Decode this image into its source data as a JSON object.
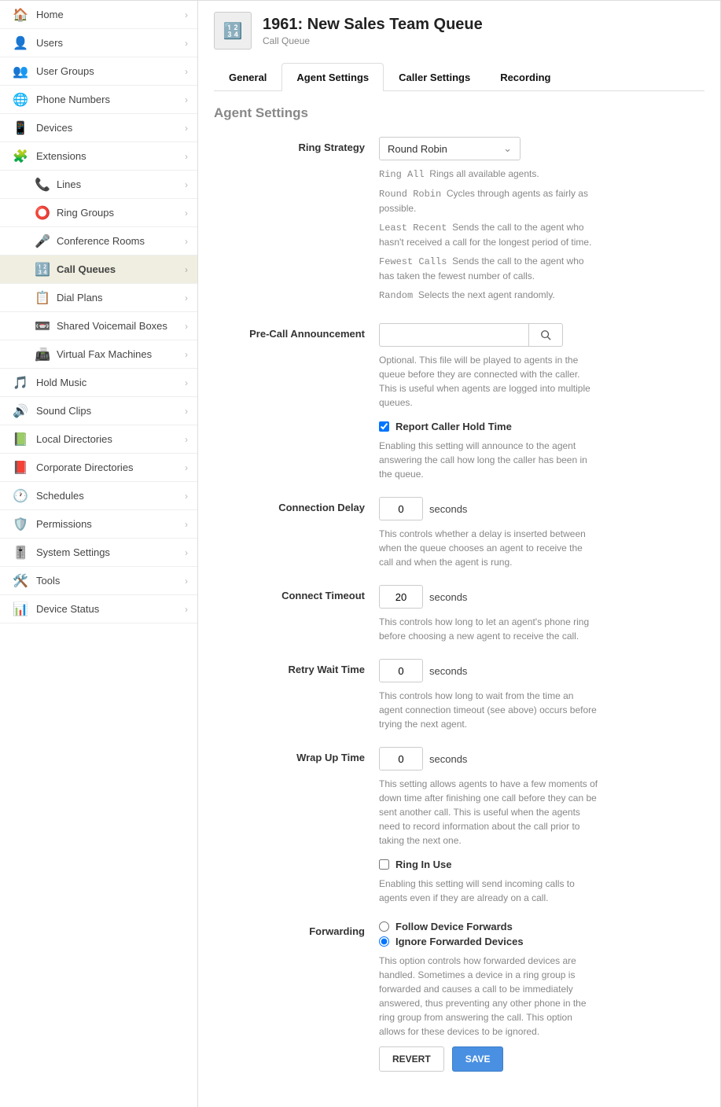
{
  "header": {
    "title": "1961: New Sales Team Queue",
    "subtitle": "Call Queue"
  },
  "tabs": [
    {
      "label": "General",
      "active": false
    },
    {
      "label": "Agent Settings",
      "active": true
    },
    {
      "label": "Caller Settings",
      "active": false
    },
    {
      "label": "Recording",
      "active": false
    }
  ],
  "section_title": "Agent Settings",
  "sidebar": [
    {
      "label": "Home",
      "sub": false
    },
    {
      "label": "Users",
      "sub": false
    },
    {
      "label": "User Groups",
      "sub": false
    },
    {
      "label": "Phone Numbers",
      "sub": false
    },
    {
      "label": "Devices",
      "sub": false
    },
    {
      "label": "Extensions",
      "sub": false
    },
    {
      "label": "Lines",
      "sub": true
    },
    {
      "label": "Ring Groups",
      "sub": true
    },
    {
      "label": "Conference Rooms",
      "sub": true
    },
    {
      "label": "Call Queues",
      "sub": true,
      "active": true
    },
    {
      "label": "Dial Plans",
      "sub": true
    },
    {
      "label": "Shared Voicemail Boxes",
      "sub": true
    },
    {
      "label": "Virtual Fax Machines",
      "sub": true
    },
    {
      "label": "Hold Music",
      "sub": false
    },
    {
      "label": "Sound Clips",
      "sub": false
    },
    {
      "label": "Local Directories",
      "sub": false
    },
    {
      "label": "Corporate Directories",
      "sub": false
    },
    {
      "label": "Schedules",
      "sub": false
    },
    {
      "label": "Permissions",
      "sub": false
    },
    {
      "label": "System Settings",
      "sub": false
    },
    {
      "label": "Tools",
      "sub": false
    },
    {
      "label": "Device Status",
      "sub": false
    }
  ],
  "form": {
    "ring_strategy": {
      "label": "Ring Strategy",
      "value": "Round Robin",
      "options": [
        {
          "name": "Ring All",
          "desc": "Rings all available agents."
        },
        {
          "name": "Round Robin",
          "desc": "Cycles through agents as fairly as possible."
        },
        {
          "name": "Least Recent",
          "desc": "Sends the call to the agent who hasn't received a call for the longest period of time."
        },
        {
          "name": "Fewest Calls",
          "desc": "Sends the call to the agent who has taken the fewest number of calls."
        },
        {
          "name": "Random",
          "desc": "Selects the next agent randomly."
        }
      ]
    },
    "pre_call": {
      "label": "Pre-Call Announcement",
      "value": "",
      "help": "Optional. This file will be played to agents in the queue before they are connected with the caller. This is useful when agents are logged into multiple queues."
    },
    "report_hold": {
      "label": "Report Caller Hold Time",
      "checked": true,
      "help": "Enabling this setting will announce to the agent answering the call how long the caller has been in the queue."
    },
    "connection_delay": {
      "label": "Connection Delay",
      "value": "0",
      "unit": "seconds",
      "help": "This controls whether a delay is inserted between when the queue chooses an agent to receive the call and when the agent is rung."
    },
    "connect_timeout": {
      "label": "Connect Timeout",
      "value": "20",
      "unit": "seconds",
      "help": "This controls how long to let an agent's phone ring before choosing a new agent to receive the call."
    },
    "retry_wait": {
      "label": "Retry Wait Time",
      "value": "0",
      "unit": "seconds",
      "help": "This controls how long to wait from the time an agent connection timeout (see above) occurs before trying the next agent."
    },
    "wrap_up": {
      "label": "Wrap Up Time",
      "value": "0",
      "unit": "seconds",
      "help": "This setting allows agents to have a few moments of down time after finishing one call before they can be sent another call. This is useful when the agents need to record information about the call prior to taking the next one."
    },
    "ring_in_use": {
      "label": "Ring In Use",
      "checked": false,
      "help": "Enabling this setting will send incoming calls to agents even if they are already on a call."
    },
    "forwarding": {
      "label": "Forwarding",
      "option_follow": "Follow Device Forwards",
      "option_ignore": "Ignore Forwarded Devices",
      "selected": "ignore",
      "help": "This option controls how forwarded devices are handled. Sometimes a device in a ring group is forwarded and causes a call to be immediately answered, thus preventing any other phone in the ring group from answering the call. This option allows for these devices to be ignored."
    }
  },
  "buttons": {
    "revert": "REVERT",
    "save": "SAVE"
  }
}
